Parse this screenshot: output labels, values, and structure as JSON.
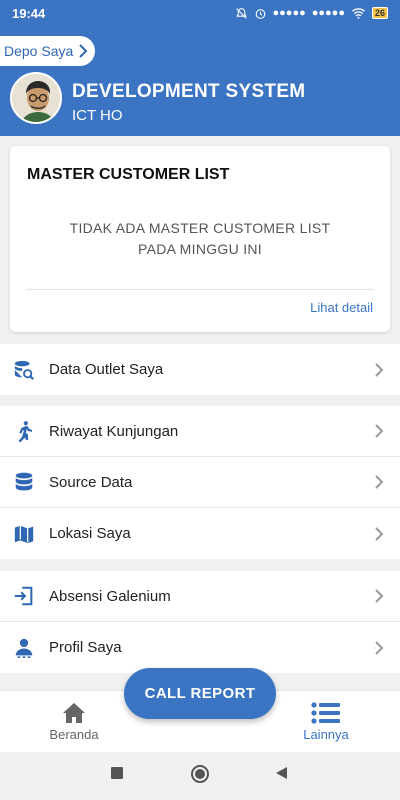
{
  "status_bar": {
    "time": "19:44",
    "signal_1": "●●●●●",
    "signal_2": "●●●●●",
    "battery": "26"
  },
  "header": {
    "depo_label": "Depo Saya",
    "title": "DEVELOPMENT SYSTEM",
    "subtitle": "ICT HO",
    "background_color": "#3b74c2"
  },
  "master_card": {
    "title": "MASTER CUSTOMER LIST",
    "empty_message": "TIDAK ADA MASTER CUSTOMER LIST PADA MINGGU INI",
    "link_label": "Lihat detail"
  },
  "menu_groups": [
    {
      "items": [
        {
          "label": "Data Outlet Saya",
          "icon": "database-search-icon"
        }
      ]
    },
    {
      "items": [
        {
          "label": "Riwayat Kunjungan",
          "icon": "walking-person-icon"
        },
        {
          "label": "Source Data",
          "icon": "database-icon"
        },
        {
          "label": "Lokasi Saya",
          "icon": "map-icon"
        }
      ]
    },
    {
      "items": [
        {
          "label": "Absensi Galenium",
          "icon": "sign-in-icon"
        },
        {
          "label": "Profil Saya",
          "icon": "user-icon"
        }
      ]
    }
  ],
  "call_button": {
    "label": "CALL REPORT"
  },
  "bottom_nav": {
    "home_label": "Beranda",
    "more_label": "Lainnya",
    "active": "Lainnya",
    "accent_color": "#3b74c2"
  }
}
